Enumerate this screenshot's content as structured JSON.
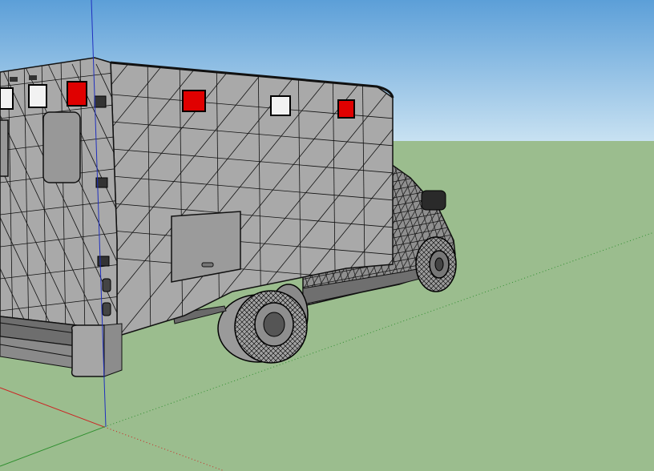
{
  "viewport": {
    "sky_top_color": "#5c9fd8",
    "sky_horizon_color": "#c9e2f2",
    "ground_color": "#9bbd8e"
  },
  "model": {
    "body_color": "#a9a9a9",
    "body_shade_color": "#8f8f8f",
    "wire_color": "#111111",
    "red_light_color": "#e00000",
    "white_light_color": "#f2f2f2"
  },
  "axes": {
    "red_axis_color": "#cc2222",
    "green_axis_color": "#2f8f2f",
    "blue_axis_color": "#1f2fbf"
  }
}
